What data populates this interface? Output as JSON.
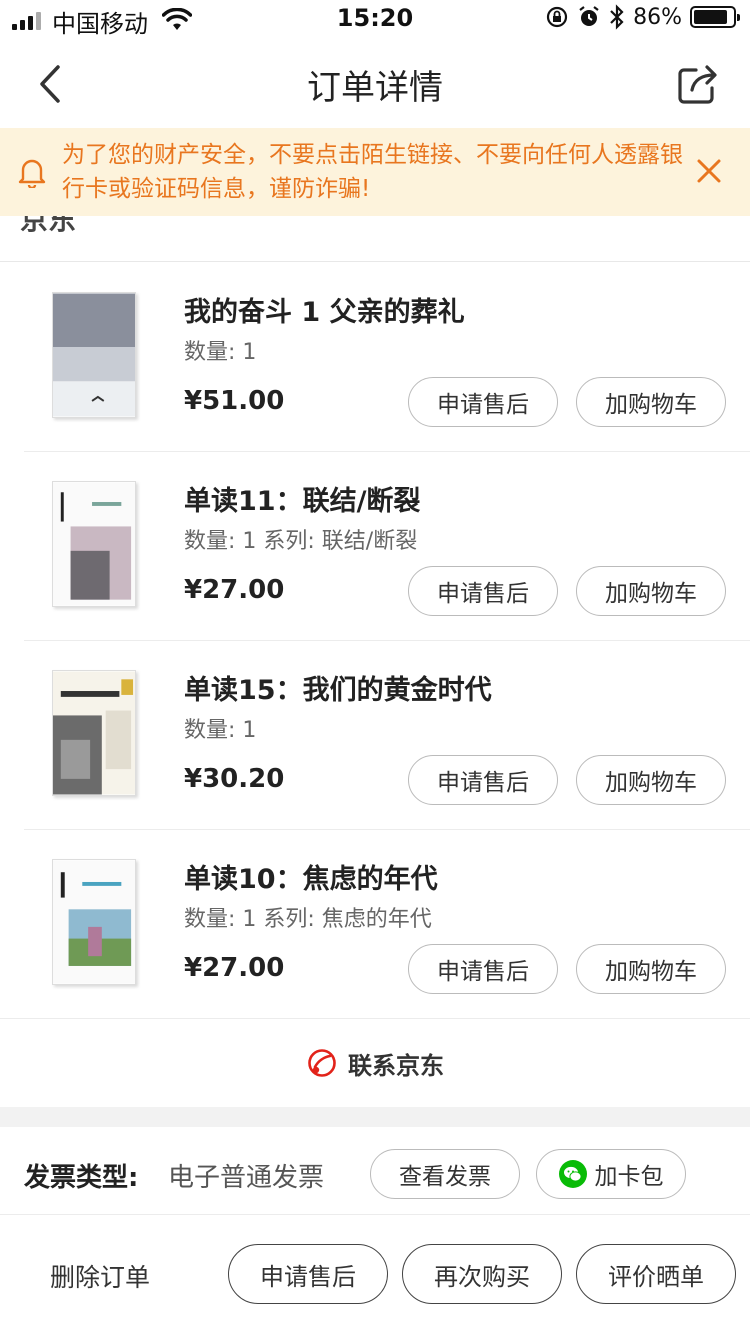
{
  "status_bar": {
    "carrier": "中国移动",
    "time": "15:20",
    "battery_text": "86%",
    "battery_level": 0.86
  },
  "nav": {
    "title": "订单详情"
  },
  "notice": {
    "text": "为了您的财产安全，不要点击陌生链接、不要向任何人透露银行卡或验证码信息，谨防诈骗!",
    "color": "#e8761f",
    "background": "#fdf3dc"
  },
  "shop": {
    "name": "京东"
  },
  "items": [
    {
      "title": "我的奋斗 1 父亲的葬礼",
      "meta": "数量: 1",
      "price": "¥51.00",
      "aftersale_label": "申请售后",
      "cart_label": "加购物车"
    },
    {
      "title": "单读11：联结/断裂",
      "meta": "数量: 1 系列: 联结/断裂",
      "price": "¥27.00",
      "aftersale_label": "申请售后",
      "cart_label": "加购物车"
    },
    {
      "title": "单读15：我们的黄金时代",
      "meta": "数量: 1",
      "price": "¥30.20",
      "aftersale_label": "申请售后",
      "cart_label": "加购物车"
    },
    {
      "title": "单读10：焦虑的年代",
      "meta": "数量: 1 系列: 焦虑的年代",
      "price": "¥27.00",
      "aftersale_label": "申请售后",
      "cart_label": "加购物车"
    }
  ],
  "contact": {
    "label": "联系京东",
    "icon_color": "#e2231a"
  },
  "invoice": {
    "label": "发票类型:",
    "value": "电子普通发票",
    "view_label": "查看发票",
    "wallet_label": "加卡包",
    "wallet_icon_color": "#09bb07"
  },
  "footer": {
    "delete_label": "删除订单",
    "aftersale_label": "申请售后",
    "rebuy_label": "再次购买",
    "review_label": "评价晒单"
  }
}
